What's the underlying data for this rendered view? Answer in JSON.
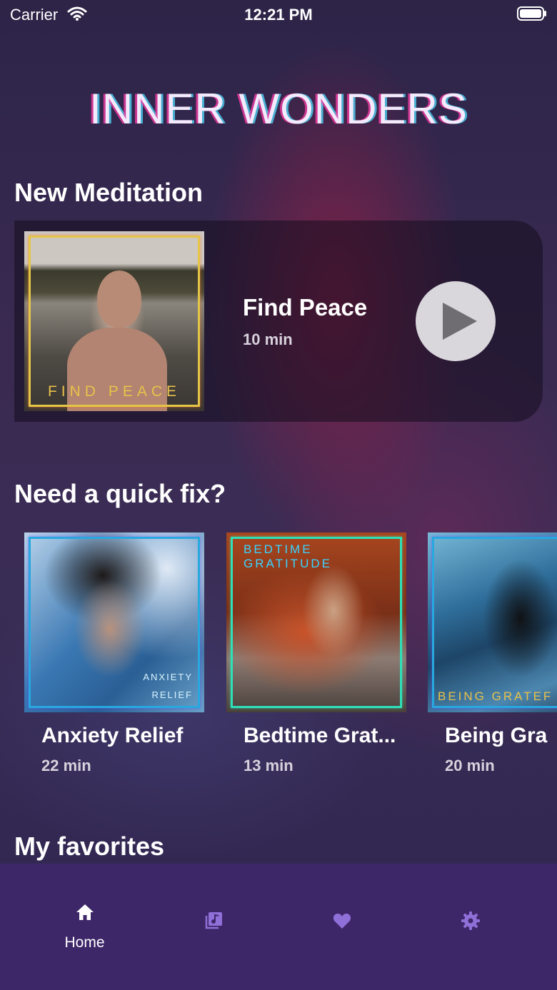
{
  "status_bar": {
    "carrier": "Carrier",
    "time": "12:21 PM"
  },
  "app": {
    "logo_text": "INNER WONDERS"
  },
  "new_meditation": {
    "section_title": "New Meditation",
    "item": {
      "cover_text": "FIND PEACE",
      "title": "Find Peace",
      "duration": "10 min"
    }
  },
  "quick_fix": {
    "section_title": "Need a quick fix?",
    "items": [
      {
        "cover_text_line1": "ANXIETY",
        "cover_text_line2": "RELIEF",
        "title": "Anxiety Relief",
        "duration": "22 min"
      },
      {
        "cover_text": "BEDTIME GRATITUDE",
        "title": "Bedtime Grat...",
        "duration": "13 min"
      },
      {
        "cover_text": "BEING GRATEF",
        "title": "Being Gra",
        "duration": "20 min"
      }
    ]
  },
  "favorites": {
    "section_title": "My favorites"
  },
  "tab_bar": {
    "tabs": [
      {
        "label": "Home",
        "icon": "home-icon",
        "active": true
      },
      {
        "label": "",
        "icon": "library-icon",
        "active": false
      },
      {
        "label": "",
        "icon": "heart-icon",
        "active": false
      },
      {
        "label": "",
        "icon": "gear-icon",
        "active": false
      }
    ],
    "inactive_color": "#8f6fd8",
    "active_color": "#ffffff",
    "background": "#3e2768"
  }
}
